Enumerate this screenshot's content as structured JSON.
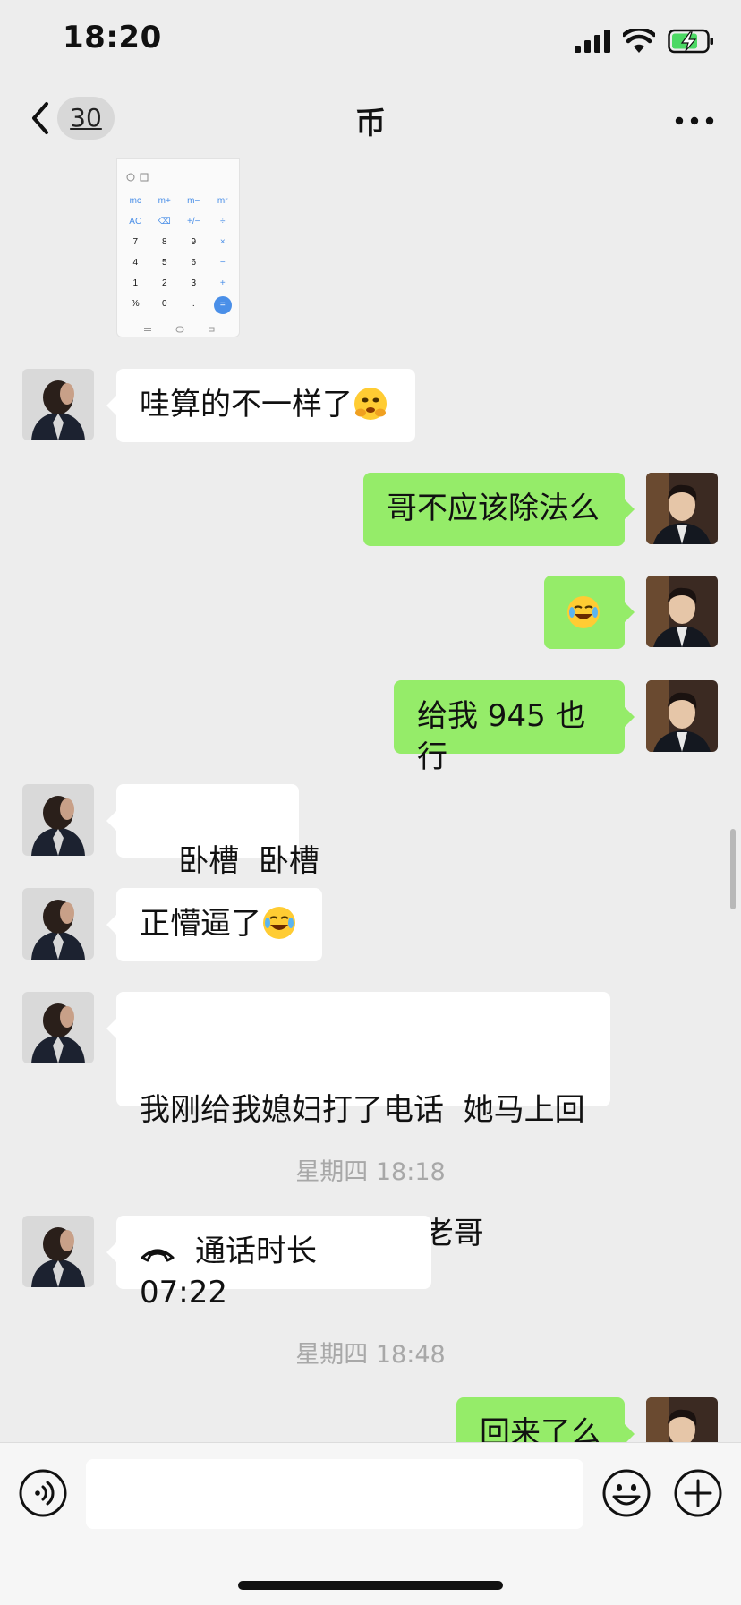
{
  "status_bar": {
    "time": "18:20"
  },
  "header": {
    "back_badge": "30",
    "title": "币"
  },
  "calculator_image": {
    "keys": [
      "mc",
      "m+",
      "m−",
      "mr",
      "AC",
      "⌫",
      "+/−",
      "÷",
      "7",
      "8",
      "9",
      "×",
      "4",
      "5",
      "6",
      "−",
      "1",
      "2",
      "3",
      "+",
      "%",
      "0",
      ".",
      "="
    ]
  },
  "messages": [
    {
      "side": "left",
      "text": "哇算的不一样了",
      "emoji": "hugging-face"
    },
    {
      "side": "right",
      "text": "哥不应该除法么"
    },
    {
      "side": "right",
      "text": "",
      "emoji": "rolling-on-floor-laughing"
    },
    {
      "side": "right",
      "text": "给我 945 也行"
    },
    {
      "side": "left",
      "text": "卧槽  卧槽"
    },
    {
      "side": "left",
      "text": "正懵逼了",
      "emoji": "rolling-on-floor-laughing"
    },
    {
      "side": "left",
      "text_line1": "我刚给我媳妇打了电话  她马上回",
      "text_line2": "来了 我用她的给你转老哥"
    },
    {
      "side": "left",
      "call": "通话时长 07:22"
    },
    {
      "side": "right",
      "text": "回来了么"
    }
  ],
  "timestamps": [
    "星期四 18:18",
    "星期四 18:48"
  ],
  "colors": {
    "bg": "#ededed",
    "bubble_green": "#95ec69",
    "bubble_white": "#ffffff"
  }
}
